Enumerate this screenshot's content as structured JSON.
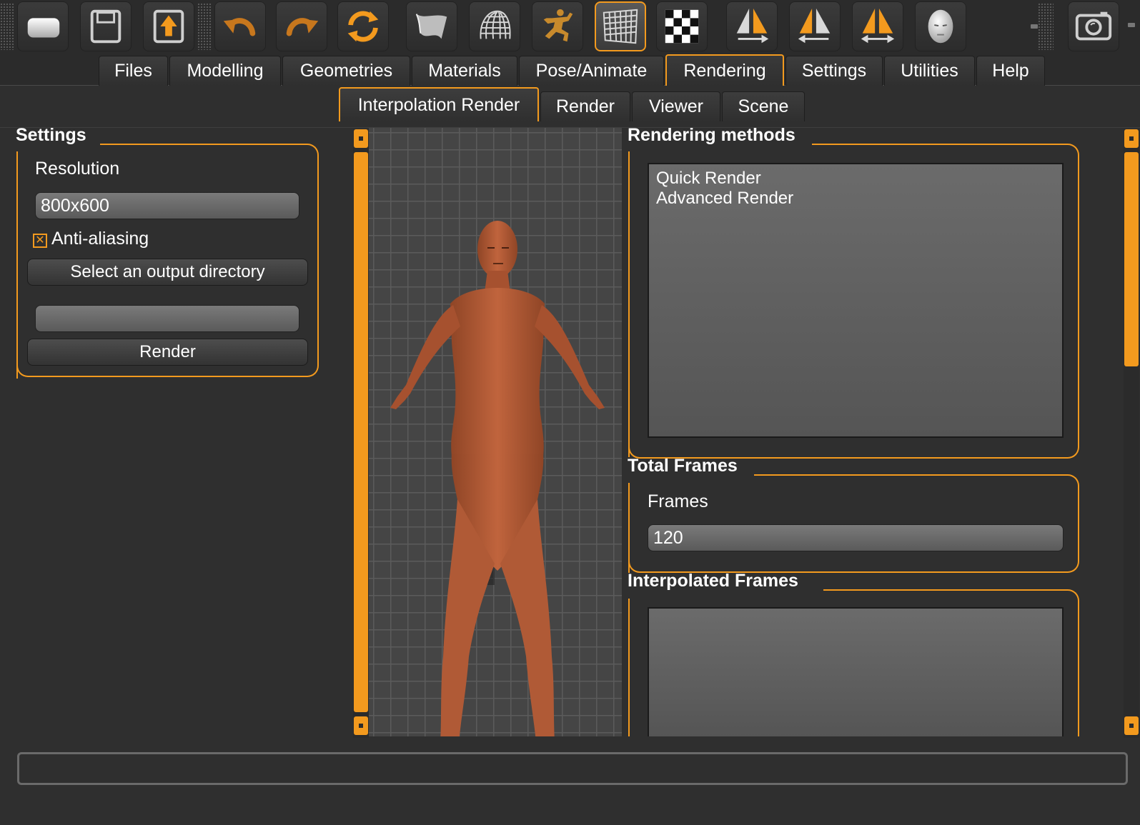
{
  "toolbar": {
    "icons": [
      "blank-icon",
      "save-icon",
      "export-icon",
      "undo-icon",
      "redo-icon",
      "reset-icon",
      "smooth-icon",
      "wireframe-icon",
      "pose-icon",
      "grid-icon",
      "background-icon",
      "symmetry-right-icon",
      "symmetry-left-icon",
      "symmetry-icon",
      "front-view-icon",
      "screenshot-icon"
    ]
  },
  "main_tabs": [
    "Files",
    "Modelling",
    "Geometries",
    "Materials",
    "Pose/Animate",
    "Rendering",
    "Settings",
    "Utilities",
    "Help"
  ],
  "active_main_tab": "Rendering",
  "sub_tabs": [
    "Interpolation Render",
    "Render",
    "Viewer",
    "Scene"
  ],
  "active_sub_tab": "Interpolation Render",
  "settings": {
    "title": "Settings",
    "resolution_label": "Resolution",
    "resolution_value": "800x600",
    "antialiasing_label": "Anti-aliasing",
    "antialiasing_checked": true,
    "output_dir_button": "Select an output directory",
    "output_dir_value": "",
    "render_button": "Render"
  },
  "rendering_methods": {
    "title": "Rendering methods",
    "items": [
      "Quick Render",
      "Advanced Render"
    ]
  },
  "total_frames": {
    "title": "Total Frames",
    "frames_label": "Frames",
    "frames_value": "120"
  },
  "interpolated_frames": {
    "title": "Interpolated Frames"
  },
  "status_bar": {
    "text": ""
  },
  "colors": {
    "accent": "#f39a1e",
    "background": "#2f2f2f",
    "skin": "#b35a36"
  }
}
